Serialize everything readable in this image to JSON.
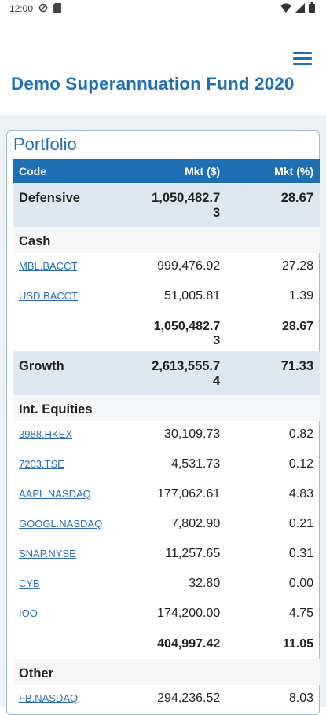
{
  "status": {
    "time": "12:00"
  },
  "app": {
    "title": "Demo Superannuation Fund 2020"
  },
  "portfolio": {
    "title": "Portfolio",
    "columns": {
      "code": "Code",
      "mkt": "Mkt ($)",
      "pct": "Mkt (%)"
    },
    "defensive": {
      "label": "Defensive",
      "mkt": "1,050,482.7\n3",
      "pct": "28.67"
    },
    "cash": {
      "label": "Cash"
    },
    "cash_rows": [
      {
        "code": "MBL.BACCT",
        "mkt": "999,476.92",
        "pct": "27.28"
      },
      {
        "code": "USD.BACCT",
        "mkt": "51,005.81",
        "pct": "1.39"
      }
    ],
    "cash_total": {
      "mkt": "1,050,482.7\n3",
      "pct": "28.67"
    },
    "growth": {
      "label": "Growth",
      "mkt": "2,613,555.7\n4",
      "pct": "71.33"
    },
    "equities": {
      "label": "Int. Equities"
    },
    "equity_rows": [
      {
        "code": "3988.HKEX",
        "mkt": "30,109.73",
        "pct": "0.82"
      },
      {
        "code": "7203.TSE",
        "mkt": "4,531.73",
        "pct": "0.12"
      },
      {
        "code": "AAPL.NASDAQ",
        "mkt": "177,062.61",
        "pct": "4.83"
      },
      {
        "code": "GOOGL.NASDAQ",
        "mkt": "7,802.90",
        "pct": "0.21"
      },
      {
        "code": "SNAP.NYSE",
        "mkt": "11,257.65",
        "pct": "0.31"
      },
      {
        "code": "CYB",
        "mkt": "32.80",
        "pct": "0.00"
      },
      {
        "code": "IOO",
        "mkt": "174,200.00",
        "pct": "4.75"
      }
    ],
    "equity_total": {
      "mkt": "404,997.42",
      "pct": "11.05"
    },
    "other": {
      "label": "Other"
    },
    "other_rows": [
      {
        "code": "FB.NASDAQ",
        "mkt": "294,236.52",
        "pct": "8.03"
      }
    ]
  }
}
